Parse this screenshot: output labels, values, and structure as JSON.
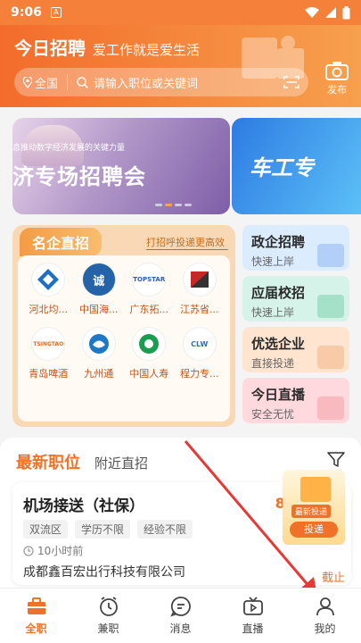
{
  "status_bar": {
    "time": "9:06",
    "notif_glyph": "A"
  },
  "header": {
    "app_name": "今日招聘",
    "slogan": "爱工作就是爱生活",
    "region": "全国",
    "search_placeholder": "请输入职位或关键词",
    "publish_label": "发布"
  },
  "banners": {
    "main_subtitle": "息推动数字经济发展的关键力量",
    "main_title": "济专场招聘会",
    "side_title": "车工专",
    "active_dot": 1,
    "dot_count": 4
  },
  "famous_companies": {
    "title": "名企直招",
    "hint": "打招呼投递更高效",
    "items": [
      {
        "name": "河北均...",
        "logo_color": "#1d6fc4"
      },
      {
        "name": "中国海...",
        "logo_color": "#2563a8"
      },
      {
        "name": "广东拓...",
        "logo_color": "#2b5cad"
      },
      {
        "name": "江苏省...",
        "logo_color": "#c62828"
      },
      {
        "name": "青岛啤酒",
        "logo_color": "#e36a1a"
      },
      {
        "name": "九州通",
        "logo_color": "#1e78c8"
      },
      {
        "name": "中国人寿",
        "logo_color": "#1a9d4f"
      },
      {
        "name": "程力专...",
        "logo_color": "#2a6fc2"
      }
    ],
    "logo_texts": [
      "",
      "诚",
      "TOPSTAR",
      "",
      "TSINGTAO",
      "",
      "",
      "CLW"
    ]
  },
  "side_cards": [
    {
      "title": "政企招聘",
      "subtitle": "快速上岸"
    },
    {
      "title": "应届校招",
      "subtitle": "快速上岸"
    },
    {
      "title": "优选企业",
      "subtitle": "直接投递"
    },
    {
      "title": "今日直播",
      "subtitle": "安全无忧"
    }
  ],
  "jobs": {
    "tab_active": "最新职位",
    "tab_other": "附近直招",
    "card": {
      "title": "机场接送（社保）",
      "salary": "8000-12",
      "tags": [
        "双流区",
        "学历不限",
        "经验不限"
      ],
      "time": "10小时前",
      "company": "成都鑫百宏出行科技有限公司"
    },
    "promo_label": "最新投递",
    "promo_button": "投递",
    "float_text": "截止"
  },
  "nav": [
    {
      "label": "全职",
      "icon": "briefcase-icon",
      "active": true
    },
    {
      "label": "兼职",
      "icon": "clock-icon",
      "active": false
    },
    {
      "label": "消息",
      "icon": "chat-icon",
      "active": false
    },
    {
      "label": "直播",
      "icon": "tv-icon",
      "active": false
    },
    {
      "label": "我的",
      "icon": "user-icon",
      "active": false
    }
  ],
  "colors": {
    "accent": "#f07228",
    "header_start": "#f36c2b",
    "header_end": "#f7a04d",
    "arrow": "#e53935"
  }
}
